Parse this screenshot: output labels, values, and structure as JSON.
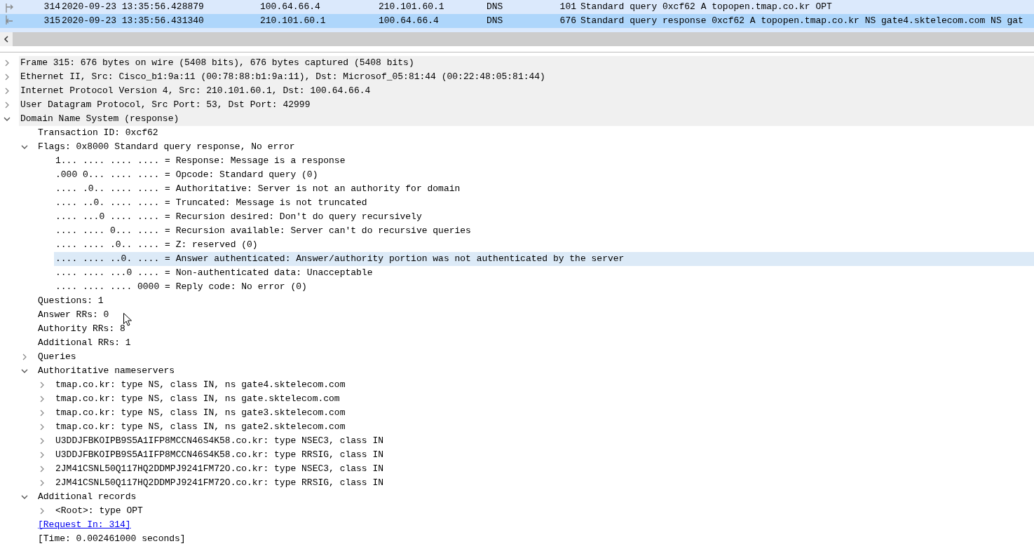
{
  "packet_list": {
    "rows": [
      {
        "kind": "request",
        "number": "314",
        "time": "2020-09-23 13:35:56.428879",
        "source": "100.64.66.4",
        "destination": "210.101.60.1",
        "protocol": "DNS",
        "length": "101",
        "info": "Standard query 0xcf62 A topopen.tmap.co.kr OPT",
        "selected": false
      },
      {
        "kind": "response",
        "number": "315",
        "time": "2020-09-23 13:35:56.431340",
        "source": "210.101.60.1",
        "destination": "100.64.66.4",
        "protocol": "DNS",
        "length": "676",
        "info": "Standard query response 0xcf62 A topopen.tmap.co.kr NS gate4.sktelecom.com NS gat",
        "selected": true
      }
    ]
  },
  "details": [
    {
      "kind": "field",
      "text": "Frame 315: 676 bytes on wire (5408 bits), 676 bytes captured (5408 bits)",
      "expanded": false,
      "selected": false
    },
    {
      "kind": "field",
      "text": "Ethernet II, Src: Cisco_b1:9a:11 (00:78:88:b1:9a:11), Dst: Microsof_05:81:44 (00:22:48:05:81:44)",
      "expanded": false,
      "selected": false
    },
    {
      "kind": "field",
      "text": "Internet Protocol Version 4, Src: 210.101.60.1, Dst: 100.64.66.4",
      "expanded": false,
      "selected": false
    },
    {
      "kind": "field",
      "text": "User Datagram Protocol, Src Port: 53, Dst Port: 42999",
      "expanded": false,
      "selected": false
    },
    {
      "kind": "field",
      "text": "Domain Name System (response)",
      "expanded": true,
      "selected": false,
      "children": [
        {
          "kind": "field",
          "text": "Transaction ID: 0xcf62",
          "selected": false
        },
        {
          "kind": "field",
          "text": "Flags: 0x8000 Standard query response, No error",
          "expanded": true,
          "selected": false,
          "children": [
            {
              "kind": "field",
              "text": "1... .... .... .... = Response: Message is a response",
              "selected": false
            },
            {
              "kind": "field",
              "text": ".000 0... .... .... = Opcode: Standard query (0)",
              "selected": false
            },
            {
              "kind": "field",
              "text": ".... .0.. .... .... = Authoritative: Server is not an authority for domain",
              "selected": false
            },
            {
              "kind": "field",
              "text": ".... ..0. .... .... = Truncated: Message is not truncated",
              "selected": false
            },
            {
              "kind": "field",
              "text": ".... ...0 .... .... = Recursion desired: Don't do query recursively",
              "selected": false
            },
            {
              "kind": "field",
              "text": ".... .... 0... .... = Recursion available: Server can't do recursive queries",
              "selected": false
            },
            {
              "kind": "field",
              "text": ".... .... .0.. .... = Z: reserved (0)",
              "selected": false
            },
            {
              "kind": "field",
              "text": ".... .... ..0. .... = Answer authenticated: Answer/authority portion was not authenticated by the server",
              "selected": true
            },
            {
              "kind": "field",
              "text": ".... .... ...0 .... = Non-authenticated data: Unacceptable",
              "selected": false
            },
            {
              "kind": "field",
              "text": ".... .... .... 0000 = Reply code: No error (0)",
              "selected": false
            }
          ]
        },
        {
          "kind": "field",
          "text": "Questions: 1",
          "selected": false
        },
        {
          "kind": "field",
          "text": "Answer RRs: 0",
          "selected": false
        },
        {
          "kind": "field",
          "text": "Authority RRs: 8",
          "selected": false
        },
        {
          "kind": "field",
          "text": "Additional RRs: 1",
          "selected": false
        },
        {
          "kind": "field",
          "text": "Queries",
          "expanded": false,
          "selected": false
        },
        {
          "kind": "field",
          "text": "Authoritative nameservers",
          "expanded": true,
          "selected": false,
          "children": [
            {
              "kind": "field",
              "text": "tmap.co.kr: type NS, class IN, ns gate4.sktelecom.com",
              "expanded": false,
              "selected": false
            },
            {
              "kind": "field",
              "text": "tmap.co.kr: type NS, class IN, ns gate.sktelecom.com",
              "expanded": false,
              "selected": false
            },
            {
              "kind": "field",
              "text": "tmap.co.kr: type NS, class IN, ns gate3.sktelecom.com",
              "expanded": false,
              "selected": false
            },
            {
              "kind": "field",
              "text": "tmap.co.kr: type NS, class IN, ns gate2.sktelecom.com",
              "expanded": false,
              "selected": false
            },
            {
              "kind": "field",
              "text": "U3DDJFBKOIPB9S5A1IFP8MCCN46S4K58.co.kr: type NSEC3, class IN",
              "expanded": false,
              "selected": false
            },
            {
              "kind": "field",
              "text": "U3DDJFBKOIPB9S5A1IFP8MCCN46S4K58.co.kr: type RRSIG, class IN",
              "expanded": false,
              "selected": false
            },
            {
              "kind": "field",
              "text": "2JM41CSNL50Q117HQ2DDMPJ9241FM72O.co.kr: type NSEC3, class IN",
              "expanded": false,
              "selected": false
            },
            {
              "kind": "field",
              "text": "2JM41CSNL50Q117HQ2DDMPJ9241FM72O.co.kr: type RRSIG, class IN",
              "expanded": false,
              "selected": false
            }
          ]
        },
        {
          "kind": "field",
          "text": "Additional records",
          "expanded": true,
          "selected": false,
          "children": [
            {
              "kind": "field",
              "text": "<Root>: type OPT",
              "expanded": false,
              "selected": false
            }
          ]
        },
        {
          "kind": "link",
          "text": "[Request In: 314]",
          "selected": false
        },
        {
          "kind": "field",
          "text": "[Time: 0.002461000 seconds]",
          "selected": false
        }
      ]
    }
  ]
}
